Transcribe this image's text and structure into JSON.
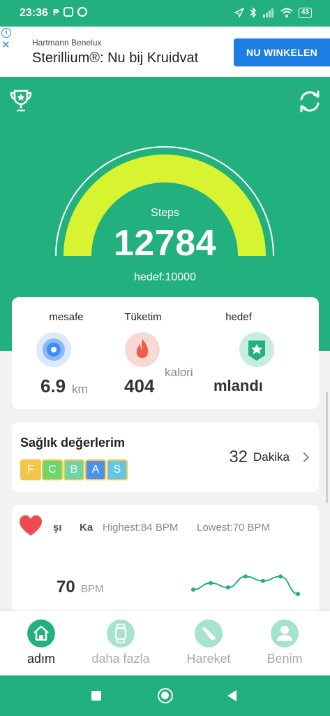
{
  "status_bar": {
    "time": "23:36",
    "battery": "43",
    "icons": [
      "notification-icon",
      "instagram-icon",
      "pinterest-icon",
      "location-icon",
      "bluetooth-icon",
      "signal-icon",
      "wifi-icon",
      "battery-icon"
    ]
  },
  "ad": {
    "company": "Hartmann Benelux",
    "headline": "Sterillium®: Nu bij Kruidvat",
    "button": "NU WINKELEN"
  },
  "gauge": {
    "label": "Steps",
    "value": "12784",
    "goal": "hedef:10000",
    "progress": 1.0,
    "arc_color": "#d8f431"
  },
  "stats": [
    {
      "title": "mesafe",
      "value": "6.9",
      "unit": "km",
      "icon": "location-pin-icon",
      "color": "#3d8ef0"
    },
    {
      "title": "Tüketim",
      "value": "404",
      "unit": "kalori",
      "icon": "flame-icon",
      "color": "#ef5b4d"
    },
    {
      "title": "hedef",
      "value": "mlandı",
      "unit": "",
      "icon": "flag-badge-icon",
      "color": "#21b07e"
    }
  ],
  "health": {
    "title": "Sağlık değerlerim",
    "grades": [
      "F",
      "C",
      "B",
      "A",
      "S"
    ],
    "grade_colors": [
      "#f5c54a",
      "#6cd66f",
      "#6cd6a8",
      "#4a90ee",
      "#63c6e6"
    ],
    "minutes": "32",
    "unit": "Dakika"
  },
  "heart": {
    "tabs": [
      "şı",
      "Ka"
    ],
    "highest": "Highest:84  BPM",
    "lowest": "Lowest:70  BPM",
    "value": "70",
    "unit": "BPM"
  },
  "chart_data": {
    "type": "line",
    "values": [
      72,
      75,
      73,
      78,
      76,
      78,
      70
    ],
    "ylim": [
      66,
      82
    ]
  },
  "bottom_nav": [
    {
      "label": "adım",
      "icon": "home-icon",
      "active": true
    },
    {
      "label": "daha fazla",
      "icon": "watch-icon",
      "active": false
    },
    {
      "label": "Hareket",
      "icon": "shoe-icon",
      "active": false
    },
    {
      "label": "Benim",
      "icon": "person-icon",
      "active": false
    }
  ]
}
